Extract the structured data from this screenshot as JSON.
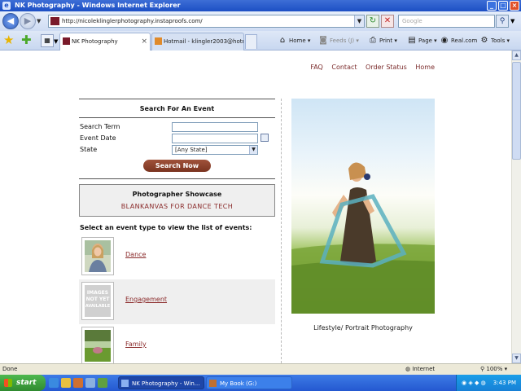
{
  "window": {
    "title": "NK Photography - Windows Internet Explorer"
  },
  "browser": {
    "url": "http://nicoleklinglerphotography.instaproofs.com/",
    "search_placeholder": "Google",
    "tabs": [
      {
        "label": "NK Photography"
      },
      {
        "label": "Hotmail - klingler2003@hotmail...."
      }
    ],
    "commands": {
      "home": "Home",
      "feeds": "Feeds (J)",
      "print": "Print",
      "page": "Page",
      "realcom": "Real.com",
      "tools": "Tools"
    }
  },
  "site": {
    "nav": [
      "FAQ",
      "Contact",
      "Order Status",
      "Home"
    ],
    "search": {
      "title": "Search For An Event",
      "term_label": "Search Term",
      "date_label": "Event Date",
      "state_label": "State",
      "state_value": "[Any State]",
      "button": "Search Now"
    },
    "showcase": {
      "title": "Photographer Showcase",
      "link": "BLANKANVAS FOR DANCE TECH"
    },
    "select_prompt": "Select an event type to view the list of events:",
    "events": [
      {
        "label": "Dance"
      },
      {
        "label": "Engagement",
        "thumb_text": [
          "IMAGES",
          "NOT YET",
          "AVAILABLE"
        ]
      },
      {
        "label": "Family"
      }
    ],
    "caption": "Lifestyle/ Portrait Photography"
  },
  "status": {
    "left": "Done",
    "zone": "Internet",
    "zoom": "100%"
  },
  "taskbar": {
    "start": "start",
    "items": [
      "NK Photography - Win...",
      "My Book (G:)"
    ],
    "clock": "3:43 PM"
  },
  "colors": {
    "accent": "#8a2a2a",
    "button": "#7a3420"
  }
}
